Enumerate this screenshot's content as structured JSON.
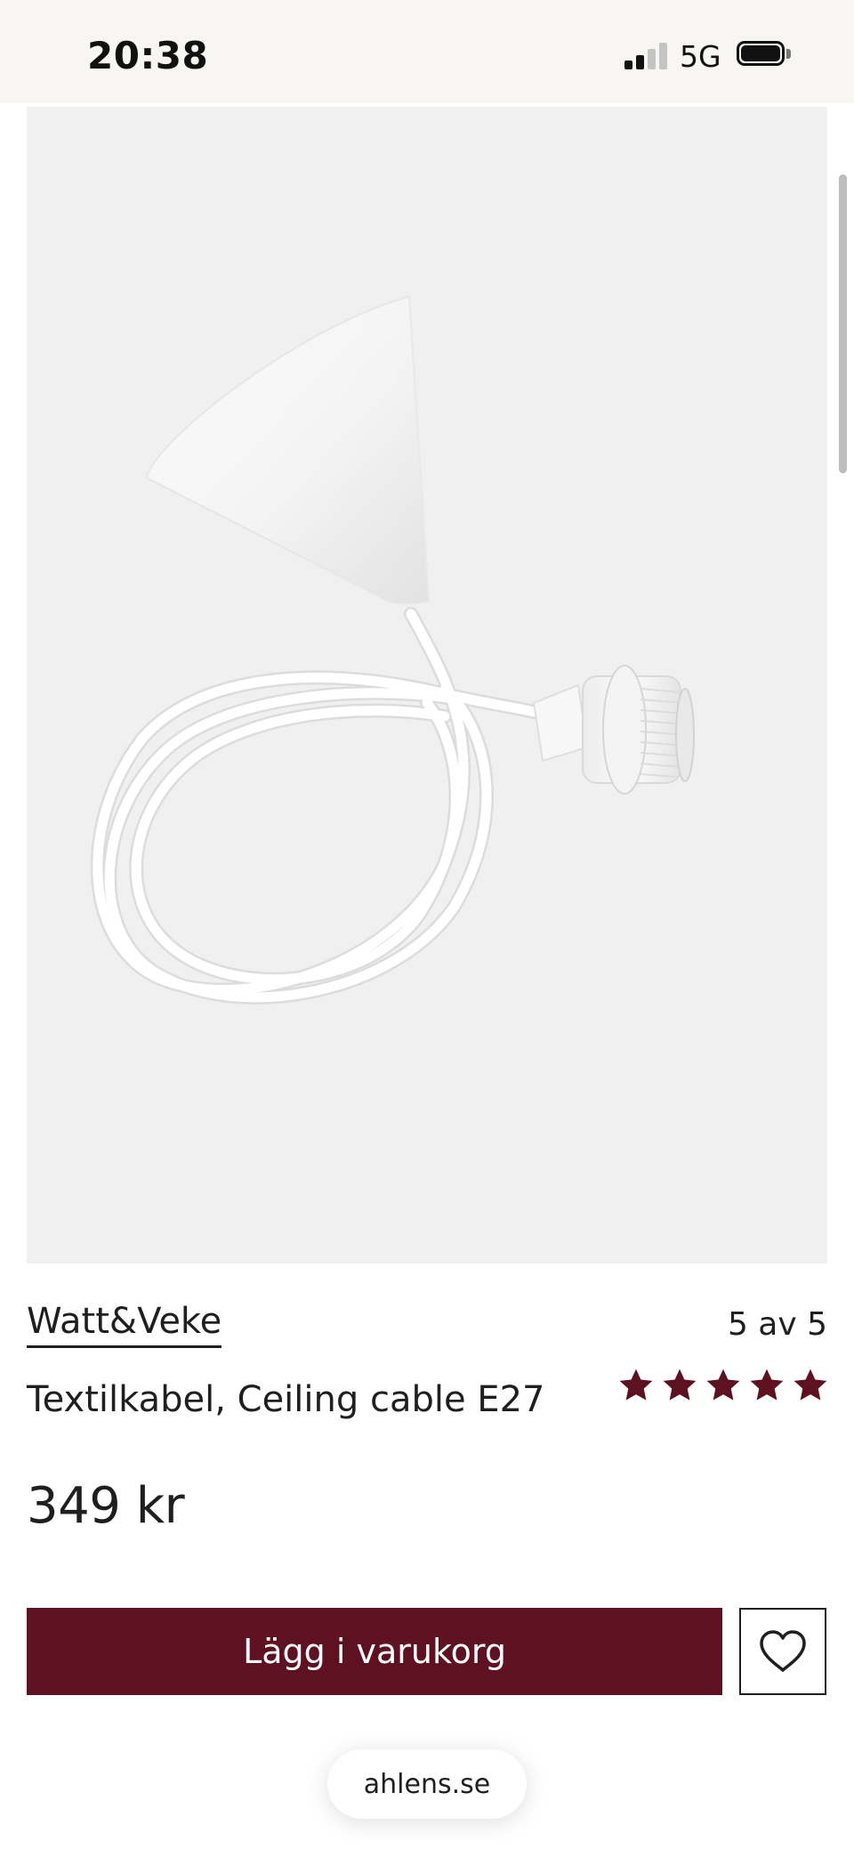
{
  "status_bar": {
    "time": "20:38",
    "network": "5G"
  },
  "product": {
    "image_icon": "ceiling-cable-pendant-image",
    "brand": "Watt&Veke",
    "name": "Textilkabel, Ceiling cable E27",
    "rating_text": "5 av 5",
    "rating_value": 5,
    "rating_max": 5,
    "price": "349 kr"
  },
  "actions": {
    "add_to_cart_label": "Lägg i varukorg",
    "wishlist_icon": "heart-icon"
  },
  "browser": {
    "url": "ahlens.se"
  },
  "colors": {
    "accent": "#5e1221",
    "status_bar_bg": "#f7f6f2",
    "image_bg": "#f0f0f0"
  }
}
